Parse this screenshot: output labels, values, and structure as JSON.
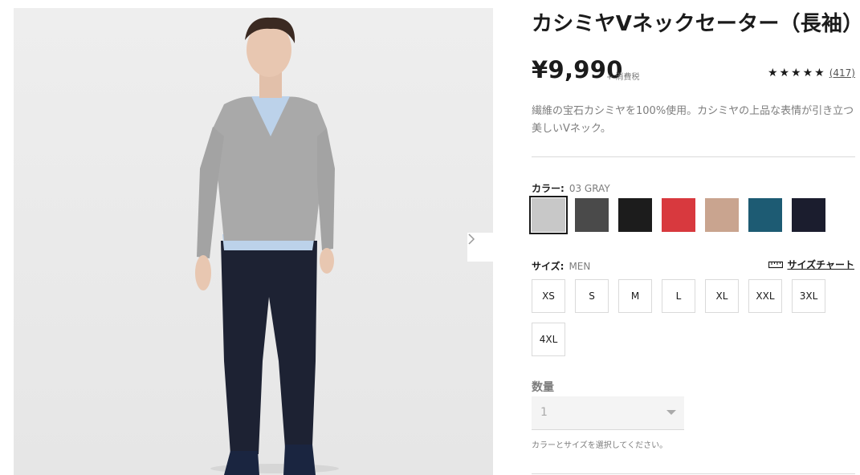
{
  "product": {
    "title": "カシミヤVネックセーター（長袖）",
    "price": "¥9,990",
    "tax_note": "+ 消費税",
    "stars": "★★★★★",
    "review_count": "(417)",
    "description": "繊維の宝石カシミヤを100%使用。カシミヤの上品な表情が引き立つ美しいVネック。"
  },
  "color": {
    "label": "カラー:",
    "selected": "03 GRAY",
    "swatches": [
      {
        "name": "light-gray",
        "hex": "#c8c8c8"
      },
      {
        "name": "dark-gray",
        "hex": "#4a4a4a"
      },
      {
        "name": "black",
        "hex": "#1c1c1c"
      },
      {
        "name": "red",
        "hex": "#d8393e"
      },
      {
        "name": "beige",
        "hex": "#c9a48f"
      },
      {
        "name": "teal",
        "hex": "#1d5b73"
      },
      {
        "name": "navy",
        "hex": "#1b1d2e"
      }
    ]
  },
  "size": {
    "label": "サイズ:",
    "selected": "MEN",
    "chart_link": "サイズチャート",
    "options": [
      "XS",
      "S",
      "M",
      "L",
      "XL",
      "XXL",
      "3XL",
      "4XL"
    ]
  },
  "quantity": {
    "label": "数量",
    "value": "1",
    "hint": "カラーとサイズを選択してください。"
  },
  "gallery": {
    "next_icon": "chevron-right-icon"
  }
}
